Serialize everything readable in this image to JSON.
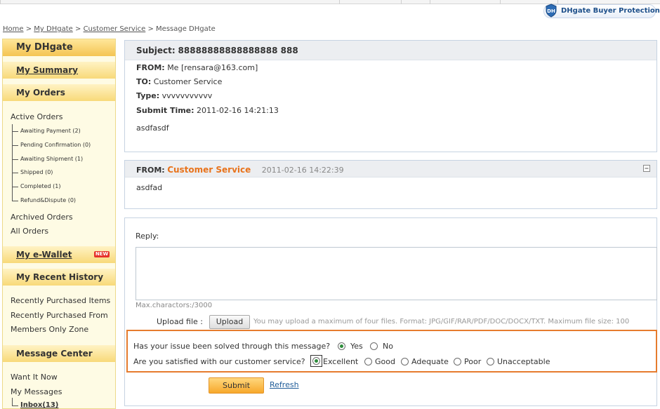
{
  "header": {
    "protection_label": "DHgate Buyer Protection"
  },
  "breadcrumb": {
    "items": [
      "Home",
      "My DHgate",
      "Customer Service"
    ],
    "current": "Message DHgate",
    "separator": ">"
  },
  "sidebar": {
    "title": "My DHgate",
    "summary": "My Summary",
    "orders_title": "My Orders",
    "active_orders": "Active Orders",
    "order_statuses": [
      "Awaiting Payment (2)",
      "Pending Confirmation (0)",
      "Awaiting Shipment (1)",
      "Shipped (0)",
      "Completed (1)",
      "Refund&Dispute (0)"
    ],
    "archived_orders": "Archived Orders",
    "all_orders": "All Orders",
    "wallet": "My e-Wallet",
    "wallet_badge": "NEW",
    "recent_history_title": "My Recent History",
    "recent_items": [
      "Recently Purchased Items",
      "Recently Purchased From",
      "Members Only Zone"
    ],
    "message_center_title": "Message Center",
    "message_items": [
      "Want It Now",
      "My Messages"
    ],
    "inbox": "Inbox(13)"
  },
  "message": {
    "subject_label": "Subject:",
    "subject": "88888888888888888 888",
    "from_label": "FROM:",
    "from": "Me [rensara@163.com]",
    "to_label": "TO:",
    "to": "Customer Service",
    "type_label": "Type:",
    "type": "vvvvvvvvvvv",
    "time_label": "Submit Time:",
    "time": "2011-02-16 14:21:13",
    "body": "asdfasdf"
  },
  "response": {
    "from_label": "FROM:",
    "from": "Customer Service",
    "time": "2011-02-16 14:22:39",
    "body": "asdfad",
    "collapse_icon": "collapse-icon"
  },
  "reply": {
    "label": "Reply:",
    "value": "",
    "max_chars": "Max.charactors:/3000",
    "upload_label": "Upload file :",
    "upload_button": "Upload",
    "upload_hint": "You may upload a maximum of four files. Format: JPG/GIF/RAR/PDF/DOC/DOCX/TXT. Maximum file size: 100"
  },
  "survey": {
    "question1": "Has your issue been solved through this message?",
    "q1_options": [
      "Yes",
      "No"
    ],
    "q1_selected": "Yes",
    "question2": "Are you satisfied with our customer service?",
    "q2_options": [
      "Excellent",
      "Good",
      "Adequate",
      "Poor",
      "Unacceptable"
    ],
    "q2_selected": "Excellent"
  },
  "actions": {
    "submit": "Submit",
    "refresh": "Refresh"
  },
  "colors": {
    "accent_orange": "#e67c2e",
    "customer_service_orange": "#e8731c",
    "link_blue": "#1f5c99",
    "sidebar_bg": "#fefbe4"
  }
}
